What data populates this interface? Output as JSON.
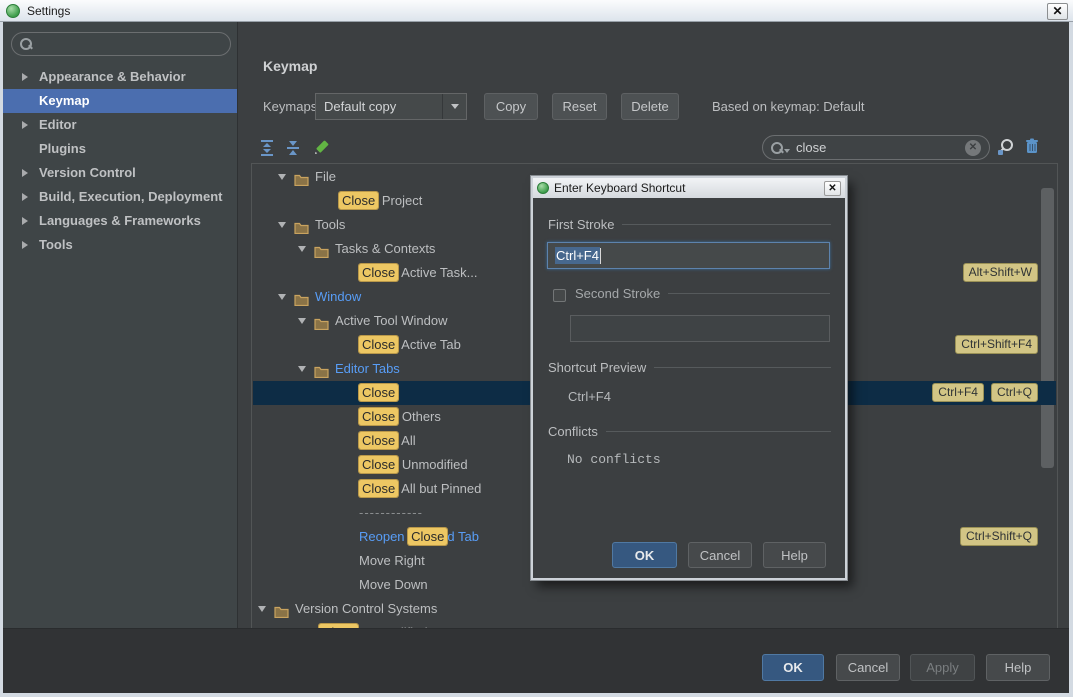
{
  "window": {
    "title": "Settings",
    "close_glyph": "✕"
  },
  "colors": {
    "accent_blue": "#4b6eaf",
    "tree_selection": "#0d2c45",
    "match_highlight": "#edc763",
    "shortcut_badge": "#d2c585",
    "link_blue": "#589df6",
    "primary_button": "#365880",
    "panel_bg": "#3c3f41",
    "footer_bg": "#313335"
  },
  "sidebar": {
    "search_value": "",
    "items": [
      {
        "label": "Appearance & Behavior",
        "expandable": true,
        "selected": false
      },
      {
        "label": "Keymap",
        "expandable": false,
        "selected": true
      },
      {
        "label": "Editor",
        "expandable": true,
        "selected": false
      },
      {
        "label": "Plugins",
        "expandable": false,
        "selected": false
      },
      {
        "label": "Version Control",
        "expandable": true,
        "selected": false
      },
      {
        "label": "Build, Execution, Deployment",
        "expandable": true,
        "selected": false
      },
      {
        "label": "Languages & Frameworks",
        "expandable": true,
        "selected": false
      },
      {
        "label": "Tools",
        "expandable": true,
        "selected": false
      }
    ]
  },
  "header": {
    "title": "Keymap",
    "keymaps_label": "Keymaps:",
    "keymap_value": "Default copy",
    "buttons": [
      "Copy",
      "Reset",
      "Delete"
    ],
    "based_on": "Based on keymap: Default"
  },
  "toolbar": {
    "search_value": "close",
    "clear_glyph": "✕"
  },
  "tree": {
    "rows": [
      {
        "type": "group",
        "level": 1,
        "label": "File"
      },
      {
        "type": "action",
        "level": 2,
        "parts": [
          {
            "t": "Close",
            "hl": true
          },
          {
            "t": " Project"
          }
        ]
      },
      {
        "type": "group",
        "level": 1,
        "label": "Tools"
      },
      {
        "type": "group",
        "level": 2,
        "label": "Tasks & Contexts"
      },
      {
        "type": "action",
        "level": 3,
        "parts": [
          {
            "t": "Close",
            "hl": true
          },
          {
            "t": " Active Task..."
          }
        ],
        "badges": [
          "Alt+Shift+W"
        ]
      },
      {
        "type": "group",
        "level": 1,
        "label": "Window",
        "blue": true
      },
      {
        "type": "group",
        "level": 2,
        "label": "Active Tool Window"
      },
      {
        "type": "action",
        "level": 3,
        "parts": [
          {
            "t": "Close",
            "hl": true
          },
          {
            "t": " Active Tab"
          }
        ],
        "badges": [
          "Ctrl+Shift+F4"
        ]
      },
      {
        "type": "group",
        "level": 2,
        "label": "Editor Tabs",
        "blue": true
      },
      {
        "type": "action",
        "level": 3,
        "parts": [
          {
            "t": "Close",
            "hl": true
          }
        ],
        "badges": [
          "Ctrl+F4",
          "Ctrl+Q"
        ],
        "selected": true
      },
      {
        "type": "action",
        "level": 3,
        "parts": [
          {
            "t": "Close",
            "hl": true
          },
          {
            "t": " Others"
          }
        ]
      },
      {
        "type": "action",
        "level": 3,
        "parts": [
          {
            "t": "Close",
            "hl": true
          },
          {
            "t": " All"
          }
        ]
      },
      {
        "type": "action",
        "level": 3,
        "parts": [
          {
            "t": "Close",
            "hl": true
          },
          {
            "t": " Unmodified"
          }
        ]
      },
      {
        "type": "action",
        "level": 3,
        "parts": [
          {
            "t": "Close",
            "hl": true
          },
          {
            "t": " All but Pinned"
          }
        ]
      },
      {
        "type": "action",
        "level": 3,
        "parts": [
          {
            "t": "------------",
            "sep": true
          }
        ]
      },
      {
        "type": "action",
        "level": 3,
        "parts": [
          {
            "t": "Reopen ",
            "blue": true
          },
          {
            "t": "Close",
            "hl": true
          },
          {
            "t": "d Tab",
            "blue": true
          }
        ],
        "badges": [
          "Ctrl+Shift+Q"
        ]
      },
      {
        "type": "action",
        "level": 3,
        "parts": [
          {
            "t": "Move Right"
          }
        ]
      },
      {
        "type": "action",
        "level": 3,
        "parts": [
          {
            "t": "Move Down"
          }
        ]
      },
      {
        "type": "group",
        "level": 0,
        "label": "Version Control Systems"
      },
      {
        "type": "action",
        "level": 1,
        "parts": [
          {
            "t": "Close",
            "hl": true
          },
          {
            "t": " Unmodified"
          }
        ]
      }
    ]
  },
  "dialog": {
    "title": "Enter Keyboard Shortcut",
    "close_glyph": "✕",
    "first_stroke_label": "First Stroke",
    "first_stroke_value": "Ctrl+F4",
    "second_stroke_label": "Second Stroke",
    "second_stroke_value": "",
    "preview_label": "Shortcut Preview",
    "preview_value": "Ctrl+F4",
    "conflicts_label": "Conflicts",
    "conflicts_value": "No conflicts",
    "buttons": {
      "ok": "OK",
      "cancel": "Cancel",
      "help": "Help"
    }
  },
  "footer": {
    "ok": "OK",
    "cancel": "Cancel",
    "apply": "Apply",
    "help": "Help"
  }
}
